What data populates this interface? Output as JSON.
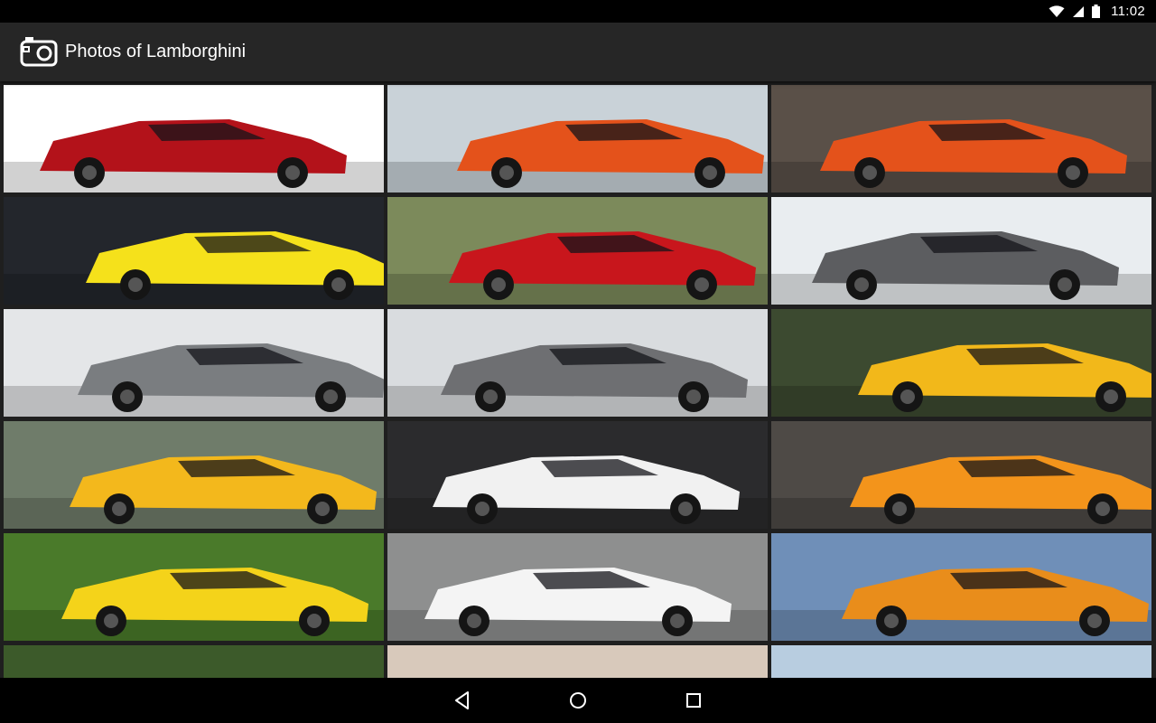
{
  "status_bar": {
    "time": "11:02",
    "icons": [
      "wifi-icon",
      "cell-signal-icon",
      "battery-icon"
    ]
  },
  "app_bar": {
    "icon": "camera-icon",
    "title": "Photos of Lamborghini"
  },
  "gallery": {
    "photos": [
      {
        "name": "photo-red-aventador-roadster",
        "bg": "#ffffff",
        "car": "#b3121a"
      },
      {
        "name": "photo-crowd-event",
        "bg": "#c9d2d8",
        "car": "#e4521b"
      },
      {
        "name": "photo-orange-aventador-garage",
        "bg": "#5a5048",
        "car": "#e4521b"
      },
      {
        "name": "photo-yellow-huracan-show",
        "bg": "#23262c",
        "car": "#f5e11b"
      },
      {
        "name": "photo-red-countach-track",
        "bg": "#7c8a5b",
        "car": "#c8161c"
      },
      {
        "name": "photo-grey-sesto-elemento",
        "bg": "#e9edf0",
        "car": "#5c5d60"
      },
      {
        "name": "photo-grey-estoque",
        "bg": "#e4e6e8",
        "car": "#7a7d80"
      },
      {
        "name": "photo-sesto-elemento-closeup",
        "bg": "#d9dcdf",
        "car": "#6e6f72"
      },
      {
        "name": "photo-yellow-gallardo-outdoor",
        "bg": "#3c4a30",
        "car": "#f2b81a"
      },
      {
        "name": "photo-lineup-field",
        "bg": "#6f7c6a",
        "car": "#f3b81c"
      },
      {
        "name": "photo-white-gallardo",
        "bg": "#2b2b2d",
        "car": "#f1f1f1"
      },
      {
        "name": "photo-orange-diablo",
        "bg": "#4e4a46",
        "car": "#f3941b"
      },
      {
        "name": "photo-yellow-diablo-grass",
        "bg": "#4a7a2a",
        "car": "#f4d31a"
      },
      {
        "name": "photo-white-gallardo-track",
        "bg": "#8e8f8f",
        "car": "#f4f4f4"
      },
      {
        "name": "photo-orange-murcielago",
        "bg": "#6f8fb8",
        "car": "#e98d1b"
      },
      {
        "name": "photo-partial-1",
        "bg": "#3c5a2a",
        "car": "#303436"
      },
      {
        "name": "photo-partial-2",
        "bg": "#d8c9bb",
        "car": "#c3242c"
      },
      {
        "name": "photo-partial-3",
        "bg": "#b8cde0",
        "car": "#d14a2a"
      }
    ]
  },
  "nav_bar": {
    "buttons": [
      "back-icon",
      "home-icon",
      "recents-icon"
    ]
  }
}
